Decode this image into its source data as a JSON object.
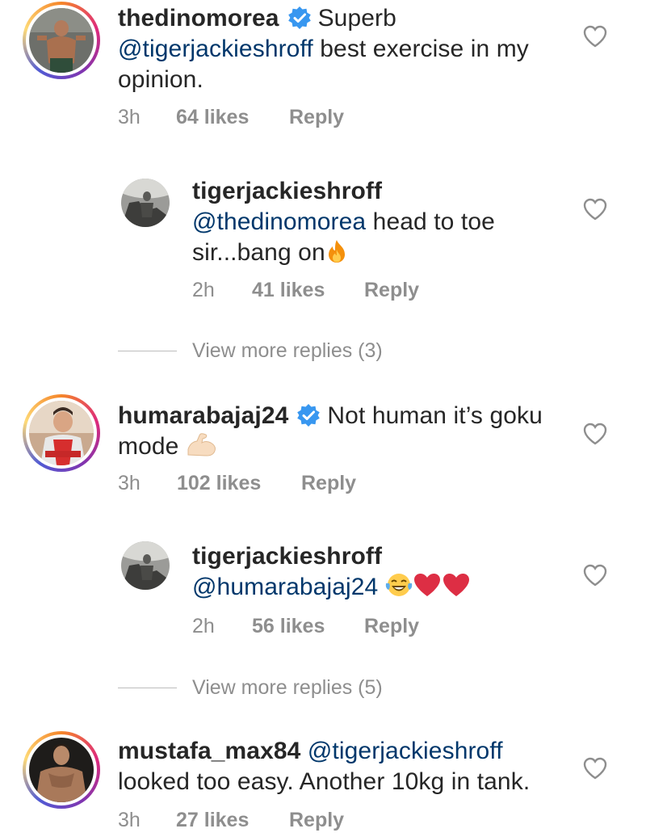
{
  "comments": [
    {
      "username": "thedinomorea",
      "verified": true,
      "text_line1_after": "Superb",
      "mention": "@tigerjackieshroff",
      "text_rest1": " best exercise in my",
      "text_line3": "opinion.",
      "time": "3h",
      "likes": "64 likes",
      "reply": "Reply",
      "replies": [
        {
          "username": "tigerjackieshroff",
          "mention": "@thedinomorea",
          "text_rest1": " head to toe",
          "text_line3": "sir...bang on",
          "emoji": "fire-emoji",
          "time": "2h",
          "likes": "41 likes",
          "reply": "Reply"
        }
      ],
      "view_more": "View more replies (3)"
    },
    {
      "username": "humarabajaj24",
      "verified": true,
      "text_line1_after": "Not human it’s goku",
      "text_line2": "mode",
      "emoji": "flexed-biceps-emoji",
      "time": "3h",
      "likes": "102 likes",
      "reply": "Reply",
      "replies": [
        {
          "username": "tigerjackieshroff",
          "mention": "@humarabajaj24",
          "emojis": [
            "laughing-emoji",
            "red-heart-emoji",
            "red-heart-emoji"
          ],
          "time": "2h",
          "likes": "56 likes",
          "reply": "Reply"
        }
      ],
      "view_more": "View more replies (5)"
    },
    {
      "username": "mustafa_max84",
      "verified": false,
      "mention": "@tigerjackieshroff",
      "text_line2": "looked too easy. Another 10kg in tank.",
      "time": "3h",
      "likes": "27 likes",
      "reply": "Reply"
    }
  ],
  "colors": {
    "text": "#262626",
    "mention": "#00376b",
    "meta": "#8e8e8e",
    "verified": "#3897f0"
  }
}
